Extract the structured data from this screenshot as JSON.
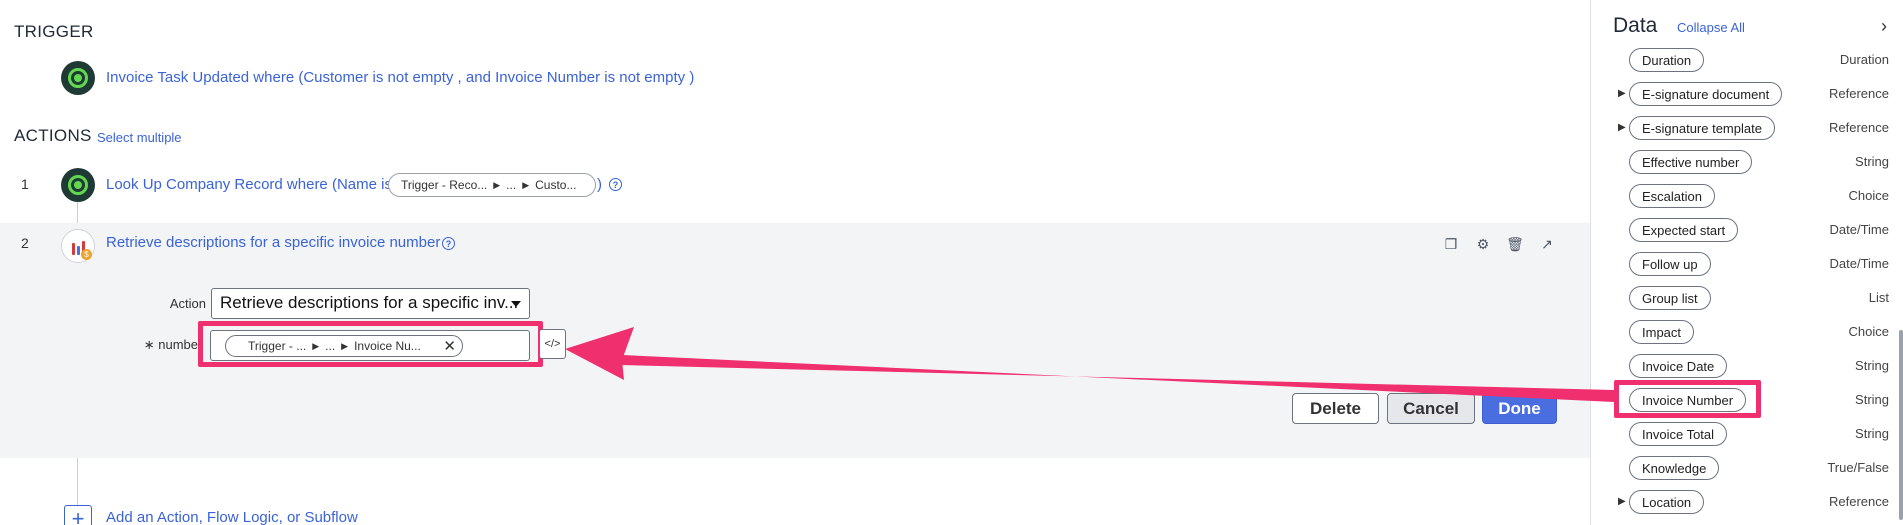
{
  "trigger": {
    "section_title": "TRIGGER",
    "text": "Invoice Task Updated where (Customer is not empty , and Invoice Number is not empty )"
  },
  "actions": {
    "section_title": "ACTIONS",
    "select_multiple": "Select multiple",
    "step1": {
      "number": "1",
      "text": "Look Up Company Record where (Name is",
      "pill": [
        "Trigger - Reco...",
        "...",
        "Custo..."
      ],
      "close_paren": ")"
    },
    "step2": {
      "number": "2",
      "title": "Retrieve descriptions for a specific invoice number",
      "action_label": "Action",
      "action_value": "Retrieve descriptions for a specific inv...",
      "number_label": "∗ numbe",
      "number_pill": [
        "Trigger - ...",
        "...",
        "Invoice Nu..."
      ]
    },
    "buttons": {
      "delete": "Delete",
      "cancel": "Cancel",
      "done": "Done"
    },
    "add_label": "Add an Action, Flow Logic, or Subflow"
  },
  "data_panel": {
    "title": "Data",
    "collapse_all": "Collapse All",
    "rows": [
      {
        "label": "Duration",
        "type": "Duration",
        "expandable": false
      },
      {
        "label": "E-signature document",
        "type": "Reference",
        "expandable": true
      },
      {
        "label": "E-signature template",
        "type": "Reference",
        "expandable": true
      },
      {
        "label": "Effective number",
        "type": "String",
        "expandable": false
      },
      {
        "label": "Escalation",
        "type": "Choice",
        "expandable": false
      },
      {
        "label": "Expected start",
        "type": "Date/Time",
        "expandable": false
      },
      {
        "label": "Follow up",
        "type": "Date/Time",
        "expandable": false
      },
      {
        "label": "Group list",
        "type": "List",
        "expandable": false
      },
      {
        "label": "Impact",
        "type": "Choice",
        "expandable": false
      },
      {
        "label": "Invoice Date",
        "type": "String",
        "expandable": false
      },
      {
        "label": "Invoice Number",
        "type": "String",
        "expandable": false
      },
      {
        "label": "Invoice Total",
        "type": "String",
        "expandable": false
      },
      {
        "label": "Knowledge",
        "type": "True/False",
        "expandable": false
      },
      {
        "label": "Location",
        "type": "Reference",
        "expandable": true
      }
    ]
  },
  "colors": {
    "accent": "#3b63d8",
    "highlight": "#ef2f6e",
    "done_button": "#4a6ee0",
    "trigger_icon": "#62d84e"
  },
  "icons": [
    "trigger-icon",
    "flow-icon",
    "help-icon",
    "copy-icon",
    "test-icon",
    "trash-icon",
    "open-external-icon",
    "script-icon",
    "close-icon",
    "plus-icon",
    "chevron-right-icon",
    "expand-triangle-icon"
  ]
}
